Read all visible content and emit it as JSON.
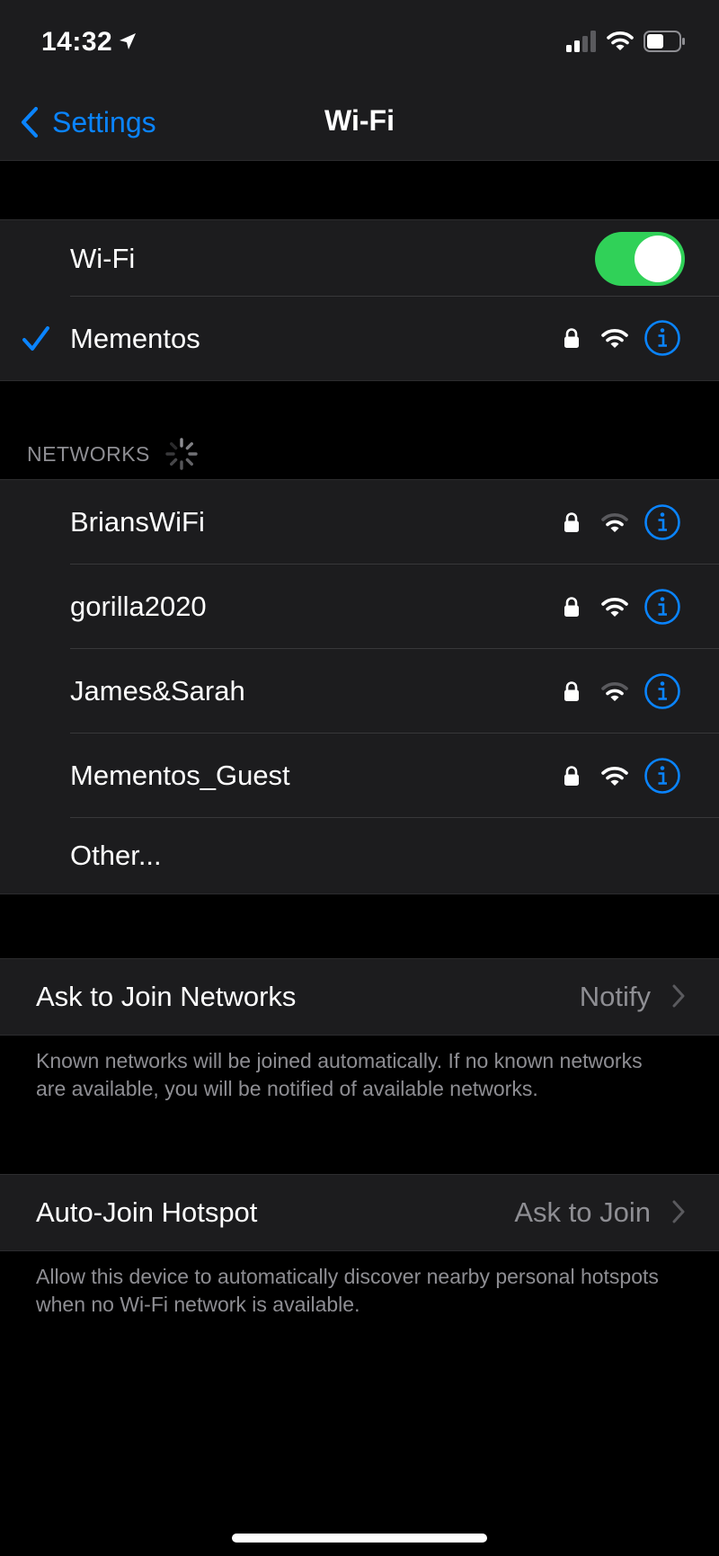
{
  "status_bar": {
    "time": "14:32"
  },
  "nav": {
    "back_label": "Settings",
    "title": "Wi-Fi"
  },
  "wifi_toggle": {
    "label": "Wi-Fi",
    "on": true
  },
  "connected": {
    "name": "Mementos"
  },
  "networks": {
    "header": "NETWORKS",
    "items": [
      {
        "name": "BriansWiFi",
        "signal": "medium"
      },
      {
        "name": "gorilla2020",
        "signal": "full"
      },
      {
        "name": "James&Sarah",
        "signal": "medium"
      },
      {
        "name": "Mementos_Guest",
        "signal": "full"
      }
    ],
    "other_label": "Other..."
  },
  "ask_to_join": {
    "label": "Ask to Join Networks",
    "value": "Notify",
    "footer": "Known networks will be joined automatically. If no known networks are available, you will be notified of available networks."
  },
  "auto_join_hotspot": {
    "label": "Auto-Join Hotspot",
    "value": "Ask to Join",
    "footer": "Allow this device to automatically discover nearby personal hotspots when no Wi-Fi network is available."
  },
  "colors": {
    "accent": "#0a84ff",
    "toggle_on": "#30d158",
    "cell_background": "#1c1c1e",
    "secondary_text": "#8e8e93"
  },
  "icons": [
    "location-arrow-icon",
    "cellular-signal-icon",
    "wifi-status-icon",
    "battery-icon",
    "chevron-left-icon",
    "checkmark-icon",
    "lock-icon",
    "wifi-signal-icon",
    "info-icon",
    "activity-spinner-icon",
    "chevron-right-icon"
  ]
}
